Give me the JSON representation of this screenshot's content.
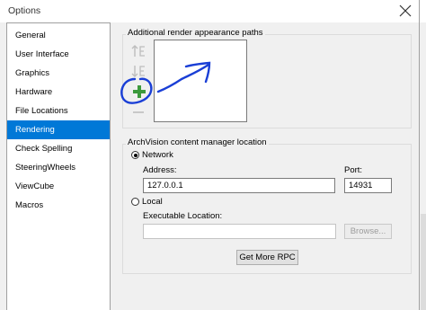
{
  "window": {
    "title": "Options"
  },
  "sidebar": {
    "items": [
      {
        "label": "General"
      },
      {
        "label": "User Interface"
      },
      {
        "label": "Graphics"
      },
      {
        "label": "Hardware"
      },
      {
        "label": "File Locations"
      },
      {
        "label": "Rendering"
      },
      {
        "label": "Check Spelling"
      },
      {
        "label": "SteeringWheels"
      },
      {
        "label": "ViewCube"
      },
      {
        "label": "Macros"
      }
    ],
    "selected": "Rendering"
  },
  "render_paths": {
    "group_label": "Additional render appearance paths"
  },
  "archvision": {
    "group_label": "ArchVision content manager location",
    "network_label": "Network",
    "address_label": "Address:",
    "address_value": "127.0.0.1",
    "port_label": "Port:",
    "port_value": "14931",
    "local_label": "Local",
    "executable_label": "Executable Location:",
    "executable_value": "",
    "browse_label": "Browse...",
    "get_more_label": "Get More RPC",
    "selected_option": "Network"
  },
  "colors": {
    "accent": "#0078d7",
    "add_icon": "#3c9a3c",
    "annotation": "#1a3fd6"
  }
}
